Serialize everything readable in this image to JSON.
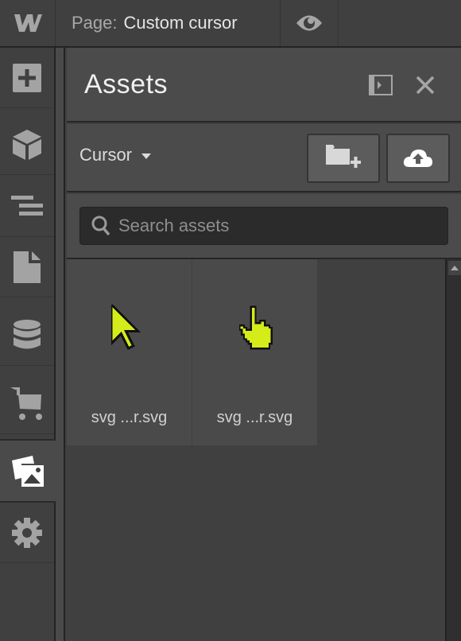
{
  "topbar": {
    "logo": "W",
    "page_label": "Page:",
    "page_name": "Custom cursor",
    "preview_icon": "eye-icon"
  },
  "sidebar": {
    "items": [
      {
        "name": "add-elements",
        "icon": "plus-square-icon"
      },
      {
        "name": "symbols",
        "icon": "cube-icon"
      },
      {
        "name": "navigator",
        "icon": "layers-list-icon"
      },
      {
        "name": "pages",
        "icon": "page-icon"
      },
      {
        "name": "cms",
        "icon": "database-icon"
      },
      {
        "name": "ecommerce",
        "icon": "cart-icon"
      },
      {
        "name": "assets",
        "icon": "images-icon",
        "active": true
      },
      {
        "name": "settings",
        "icon": "gear-icon"
      }
    ]
  },
  "panel": {
    "title": "Assets",
    "dock_icon": "dock-panel-icon",
    "close_icon": "close-icon",
    "folder": "Cursor",
    "new_folder_icon": "folder-plus-icon",
    "upload_icon": "cloud-upload-icon",
    "search_placeholder": "Search assets",
    "search_value": "",
    "assets": [
      {
        "name": "svg ...r.svg",
        "preview": "arrow-cursor"
      },
      {
        "name": "svg ...r.svg",
        "preview": "hand-pointer-cursor"
      }
    ],
    "accent_color": "#d4ec1a"
  }
}
